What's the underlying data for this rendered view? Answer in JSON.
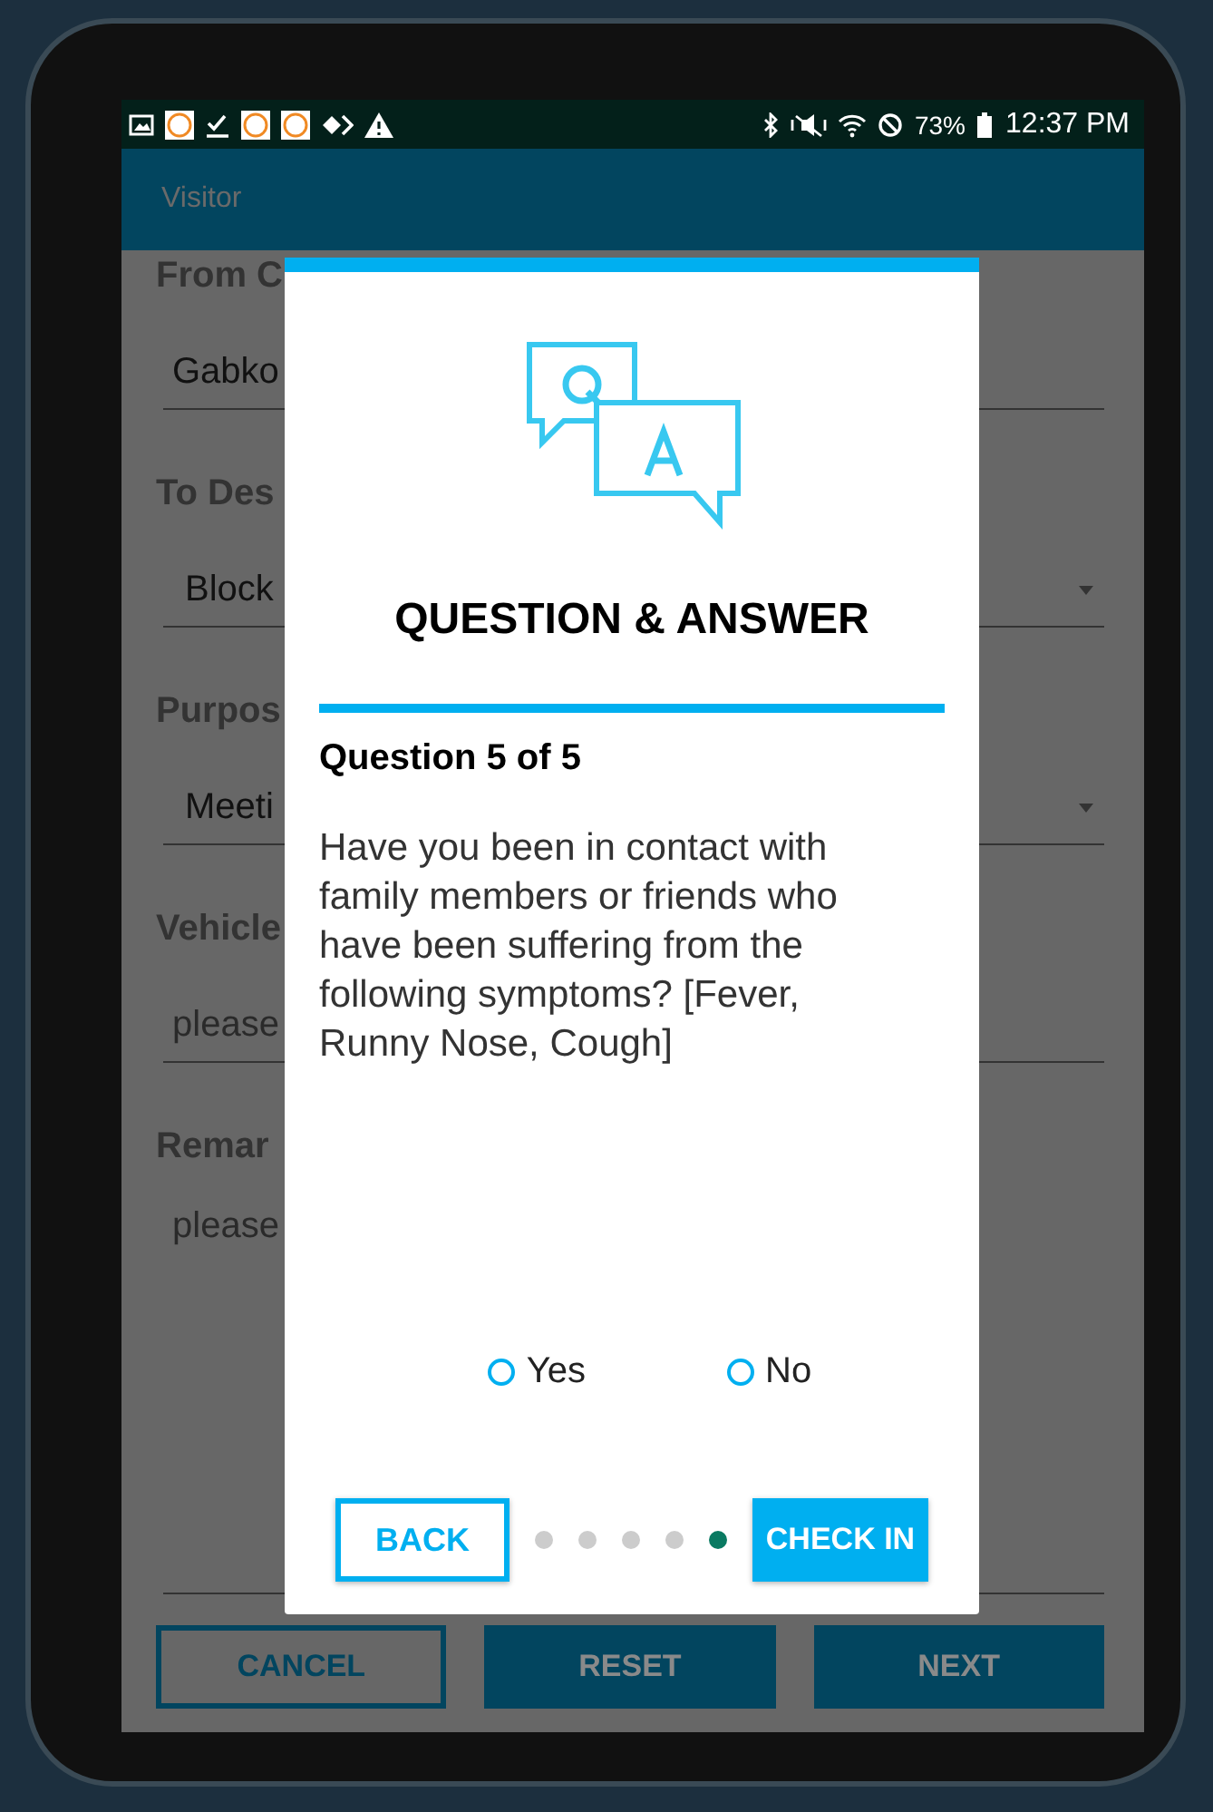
{
  "status_bar": {
    "battery": "73%",
    "time": "12:37 PM"
  },
  "app_bar": {
    "title": "Visitor"
  },
  "form": {
    "fields": [
      {
        "label": "From C",
        "value": "Gabko",
        "kind": "text"
      },
      {
        "label": "To Des",
        "value": "Block",
        "kind": "dropdown"
      },
      {
        "label": "Purpos",
        "value": "Meeti",
        "kind": "dropdown"
      },
      {
        "label": "Vehicle",
        "placeholder": "please",
        "kind": "text"
      },
      {
        "label": "Remar",
        "placeholder": "please",
        "kind": "area"
      }
    ],
    "buttons": [
      {
        "label": "CANCEL",
        "kind": "outline"
      },
      {
        "label": "RESET",
        "kind": "filled"
      },
      {
        "label": "NEXT",
        "kind": "filled"
      }
    ]
  },
  "dialog": {
    "title": "QUESTION & ANSWER",
    "progress": "Question 5 of 5",
    "question": "Have you been in contact with family members or friends who have been suffering from the following symptoms? [Fever, Runny Nose, Cough]",
    "options": [
      {
        "label": "Yes",
        "selected": false
      },
      {
        "label": "No",
        "selected": false
      }
    ],
    "pager": [
      {
        "selected": false
      },
      {
        "selected": false
      },
      {
        "selected": false
      },
      {
        "selected": false
      },
      {
        "selected": true
      }
    ],
    "back_button": "BACK",
    "check_in_button": "CHECK IN"
  }
}
